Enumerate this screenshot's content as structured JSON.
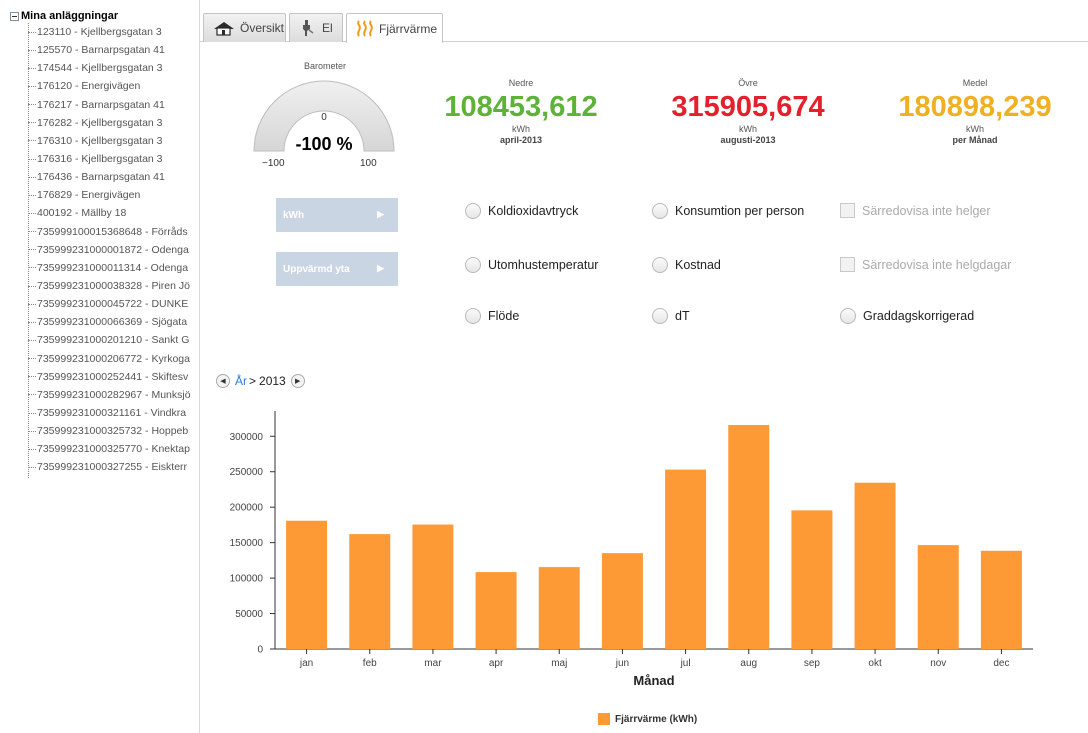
{
  "sidebar": {
    "root_label": "Mina anläggningar",
    "items": [
      "123110 - Kjellbergsgatan 3",
      "125570 - Barnarpsgatan 41",
      "174544 - Kjellbergsgatan 3",
      "176120 - Energivägen",
      "176217 - Barnarpsgatan 41",
      "176282 - Kjellbergsgatan 3",
      "176310 - Kjellbergsgatan 3",
      "176316 - Kjellbergsgatan 3",
      "176436 - Barnarpsgatan 41",
      "176829 - Energivägen",
      "400192 - Mällby 18",
      "735999100015368648 - Förråds",
      "735999231000001872 - Odenga",
      "735999231000011314 - Odenga",
      "735999231000038328 - Piren Jö",
      "735999231000045722 - DUNKE",
      "735999231000066369 - Sjögata",
      "735999231000201210 - Sankt G",
      "735999231000206772 - Kyrkoga",
      "735999231000252441 - Skiftesv",
      "735999231000282967 - Munksjö",
      "735999231000321161 - Vindkra",
      "735999231000325732 - Hoppeb",
      "735999231000325770 - Knektap",
      "735999231000327255 - Eiskterr"
    ]
  },
  "tabs": [
    {
      "label": "Översikt",
      "icon": "house-icon"
    },
    {
      "label": "El",
      "icon": "plug-icon"
    },
    {
      "label": "Fjärrvärme",
      "icon": "heat-waves-icon"
    }
  ],
  "active_tab": 2,
  "barometer": {
    "title": "Barometer",
    "center": "0",
    "value": "-100 %",
    "min": "−100",
    "max": "100",
    "level_percent": -100
  },
  "stats": [
    {
      "label": "Nedre",
      "value": "108453,612",
      "unit": "kWh",
      "period": "april-2013",
      "color": "#5db338"
    },
    {
      "label": "Övre",
      "value": "315905,674",
      "unit": "kWh",
      "period": "augusti-2013",
      "color": "#e3202b"
    },
    {
      "label": "Medel",
      "value": "180898,239",
      "unit": "kWh",
      "period": "per Månad",
      "color": "#f0b023"
    }
  ],
  "buttons": {
    "kwh": "kWh",
    "area": "Uppvärmd yta",
    "arrow": "▶"
  },
  "options": {
    "co2": "Koldioxidavtryck",
    "consumption_per_person": "Konsumtion per person",
    "no_weekends": "Särredovisa inte helger",
    "outdoor_temp": "Utomhustemperatur",
    "cost": "Kostnad",
    "no_holidays": "Särredovisa inte helgdagar",
    "flow": "Flöde",
    "dt": "dT",
    "degree_days": "Graddagskorrigerad"
  },
  "period": {
    "link": "År",
    "separator": ">",
    "year": "2013"
  },
  "chart_data": {
    "type": "bar",
    "categories": [
      "jan",
      "feb",
      "mar",
      "apr",
      "maj",
      "jun",
      "jul",
      "aug",
      "sep",
      "okt",
      "nov",
      "dec"
    ],
    "values": [
      180898,
      162000,
      175500,
      108454,
      115500,
      135200,
      253000,
      315906,
      195500,
      234500,
      146500,
      138500
    ],
    "xlabel": "Månad",
    "ylabel": "",
    "ylim": [
      0,
      330000
    ],
    "yticks": [
      0,
      50000,
      100000,
      150000,
      200000,
      250000,
      300000
    ],
    "series_name": "Fjärrvärme (kWh)",
    "color": "#fd9a36",
    "grid": false,
    "legend": "bottom-center"
  }
}
